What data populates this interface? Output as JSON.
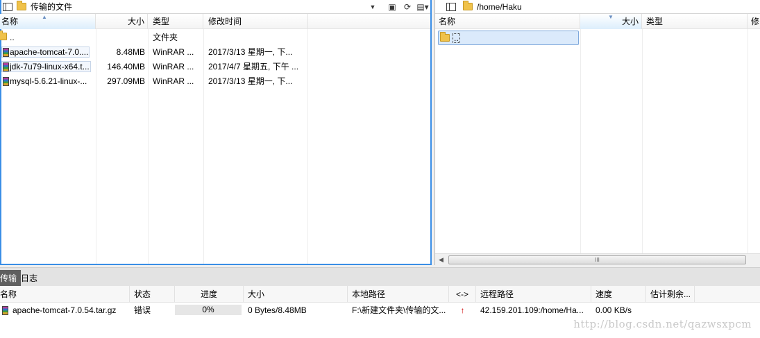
{
  "local": {
    "path": "传输的文件",
    "columns": {
      "name": "名称",
      "size": "大小",
      "type": "类型",
      "modified": "修改时间"
    },
    "rows": [
      {
        "name": "..",
        "size": "",
        "type": "文件夹",
        "modified": ""
      },
      {
        "name": "apache-tomcat-7.0....",
        "size": "8.48MB",
        "type": "WinRAR ...",
        "modified": "2017/3/13 星期一, 下..."
      },
      {
        "name": "jdk-7u79-linux-x64.t...",
        "size": "146.40MB",
        "type": "WinRAR ...",
        "modified": "2017/4/7 星期五, 下午 ..."
      },
      {
        "name": "mysql-5.6.21-linux-...",
        "size": "297.09MB",
        "type": "WinRAR ...",
        "modified": "2017/3/13 星期一, 下..."
      }
    ]
  },
  "remote": {
    "path": "/home/Haku",
    "columns": {
      "name": "名称",
      "size": "大小",
      "type": "类型",
      "modified": "修"
    },
    "rows": [
      {
        "name": ".."
      }
    ],
    "scroll_grip": "III"
  },
  "tabs": {
    "transfer": "传输",
    "log": "日志"
  },
  "queue": {
    "columns": {
      "name": "名称",
      "status": "状态",
      "progress": "进度",
      "size": "大小",
      "local_path": "本地路径",
      "direction": "<->",
      "remote_path": "远程路径",
      "speed": "速度",
      "eta": "估计剩余..."
    },
    "rows": [
      {
        "name": "apache-tomcat-7.0.54.tar.gz",
        "status": "错误",
        "progress": "0%",
        "progress_value": 0,
        "size": "0 Bytes/8.48MB",
        "local_path": "F:\\新建文件夹\\传输的文...",
        "direction": "↑",
        "remote_path": "42.159.201.109:/home/Ha...",
        "speed": "0.00 KB/s"
      }
    ]
  },
  "watermark": "http://blog.csdn.net/qazwsxpcm",
  "colors": {
    "accent": "#3a8ee6",
    "error_arrow": "#d00000",
    "active_tab": "#5f5f5f"
  }
}
